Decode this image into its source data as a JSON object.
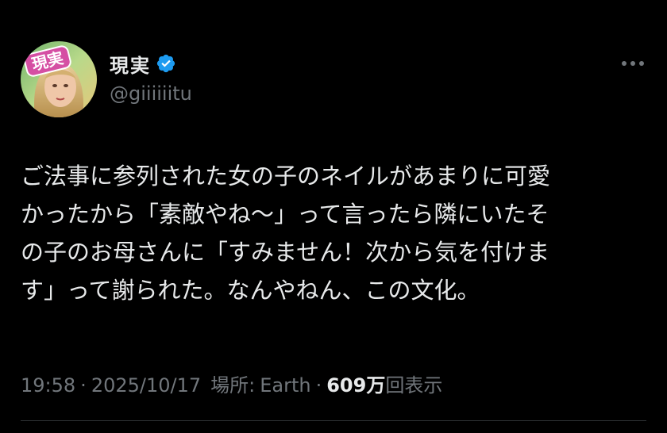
{
  "user": {
    "display_name": "現実",
    "handle": "@giiiiiitu",
    "avatar_badge": "現実",
    "verified": true
  },
  "tweet": {
    "text": "ご法事に参列された女の子のネイルがあまりに可愛\nかったから「素敵やね〜」って言ったら隣にいたそ\nの子のお母さんに「すみません！次から気を付けま\nす」って謝られた。なんやねん、この文化。"
  },
  "meta": {
    "time": "19:58",
    "separator": "·",
    "date": "2025/10/17",
    "location_label": "場所:",
    "location": "Earth",
    "views_count": "609万",
    "views_label": "回表示"
  },
  "colors": {
    "background": "#000000",
    "text_primary": "#e7e9ea",
    "text_secondary": "#71767b",
    "verified_blue": "#1d9bf0",
    "divider": "#2f3336"
  },
  "icons": {
    "verified": "verified-badge-icon",
    "more": "more-dots-icon"
  }
}
